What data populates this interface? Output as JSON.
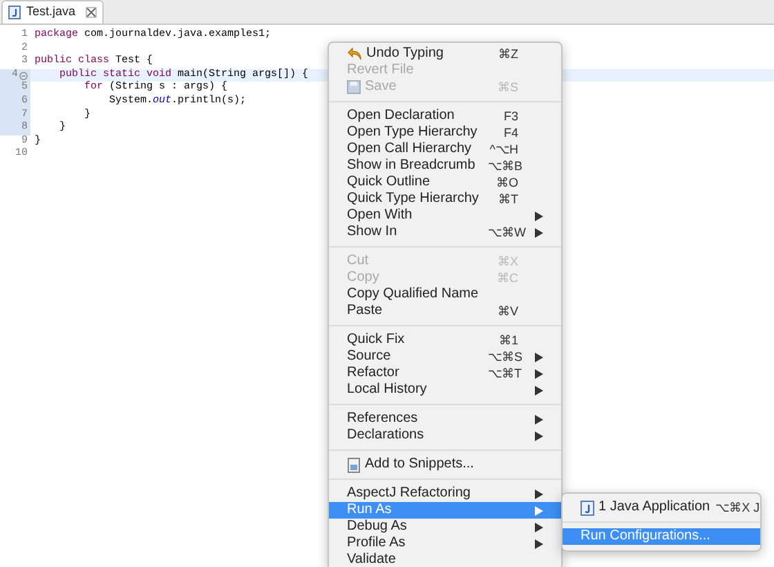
{
  "tab": {
    "title": "Test.java",
    "selected": true
  },
  "code_lines": [
    {
      "number": "1",
      "current": false,
      "in_range": false,
      "foldable": false,
      "tokens": [
        {
          "kind": "keyword",
          "text": "package"
        },
        {
          "kind": "plain",
          "text": " com.journaldev.java.examples1;"
        }
      ]
    },
    {
      "number": "2",
      "current": false,
      "in_range": false,
      "foldable": false
    },
    {
      "number": "3",
      "current": false,
      "in_range": false,
      "foldable": false,
      "tokens": [
        {
          "kind": "keyword",
          "text": "public"
        },
        {
          "kind": "keyword",
          "text": " class"
        },
        {
          "kind": "plain",
          "text": " Test {"
        }
      ]
    },
    {
      "number": "4",
      "current": true,
      "in_range": true,
      "foldable": true,
      "tokens": [
        {
          "kind": "keyword",
          "text": "    public"
        },
        {
          "kind": "keyword",
          "text": " static"
        },
        {
          "kind": "keyword",
          "text": " void"
        },
        {
          "kind": "plain",
          "text": " main(String args[]) {"
        }
      ]
    },
    {
      "number": "5",
      "current": false,
      "in_range": true,
      "foldable": false,
      "tokens": [
        {
          "kind": "keyword",
          "text": "        for"
        },
        {
          "kind": "plain",
          "text": " (String s : args) {"
        }
      ]
    },
    {
      "number": "6",
      "current": false,
      "in_range": true,
      "foldable": false,
      "tokens": [
        {
          "kind": "plain",
          "text": "            System."
        },
        {
          "kind": "field",
          "text": "out"
        },
        {
          "kind": "plain",
          "text": ".println(s);"
        }
      ]
    },
    {
      "number": "7",
      "current": false,
      "in_range": true,
      "foldable": false,
      "tokens": [
        {
          "kind": "plain",
          "text": "        }"
        }
      ]
    },
    {
      "number": "8",
      "current": false,
      "in_range": true,
      "foldable": false,
      "tokens": [
        {
          "kind": "plain",
          "text": "    }"
        }
      ]
    },
    {
      "number": "9",
      "current": false,
      "in_range": false,
      "foldable": false,
      "tokens": [
        {
          "kind": "plain",
          "text": "}"
        }
      ]
    },
    {
      "number": "10",
      "current": false,
      "in_range": false,
      "foldable": false
    }
  ],
  "context_menu": [
    {
      "kind": "item",
      "label": "Undo Typing",
      "shortcut": "⌘Z",
      "disabled": false,
      "selected": false,
      "submenu": false
    },
    {
      "kind": "item",
      "label": "Revert File",
      "disabled": true,
      "selected": false,
      "submenu": false
    },
    {
      "kind": "item",
      "label": "Save",
      "shortcut": "⌘S",
      "disabled": true,
      "selected": false,
      "submenu": false
    },
    {
      "kind": "separator"
    },
    {
      "kind": "item",
      "label": "Open Declaration",
      "shortcut": "F3",
      "disabled": false,
      "selected": false,
      "submenu": false
    },
    {
      "kind": "item",
      "label": "Open Type Hierarchy",
      "shortcut": "F4",
      "disabled": false,
      "selected": false,
      "submenu": false
    },
    {
      "kind": "item",
      "label": "Open Call Hierarchy",
      "shortcut": "^⌥H",
      "disabled": false,
      "selected": false,
      "submenu": false
    },
    {
      "kind": "item",
      "label": "Show in Breadcrumb",
      "shortcut": "⌥⌘B",
      "disabled": false,
      "selected": false,
      "submenu": false
    },
    {
      "kind": "item",
      "label": "Quick Outline",
      "shortcut": "⌘O",
      "disabled": false,
      "selected": false,
      "submenu": false
    },
    {
      "kind": "item",
      "label": "Quick Type Hierarchy",
      "shortcut": "⌘T",
      "disabled": false,
      "selected": false,
      "submenu": false
    },
    {
      "kind": "item",
      "label": "Open With",
      "disabled": false,
      "selected": false,
      "submenu": true
    },
    {
      "kind": "item",
      "label": "Show In",
      "shortcut": "⌥⌘W",
      "disabled": false,
      "selected": false,
      "submenu": true
    },
    {
      "kind": "separator"
    },
    {
      "kind": "item",
      "label": "Cut",
      "shortcut": "⌘X",
      "disabled": true,
      "selected": false,
      "submenu": false
    },
    {
      "kind": "item",
      "label": "Copy",
      "shortcut": "⌘C",
      "disabled": true,
      "selected": false,
      "submenu": false
    },
    {
      "kind": "item",
      "label": "Copy Qualified Name",
      "disabled": false,
      "selected": false,
      "submenu": false
    },
    {
      "kind": "item",
      "label": "Paste",
      "shortcut": "⌘V",
      "disabled": false,
      "selected": false,
      "submenu": false
    },
    {
      "kind": "separator"
    },
    {
      "kind": "item",
      "label": "Quick Fix",
      "shortcut": "⌘1",
      "disabled": false,
      "selected": false,
      "submenu": false
    },
    {
      "kind": "item",
      "label": "Source",
      "shortcut": "⌥⌘S",
      "disabled": false,
      "selected": false,
      "submenu": true
    },
    {
      "kind": "item",
      "label": "Refactor",
      "shortcut": "⌥⌘T",
      "disabled": false,
      "selected": false,
      "submenu": true
    },
    {
      "kind": "item",
      "label": "Local History",
      "disabled": false,
      "selected": false,
      "submenu": true
    },
    {
      "kind": "separator"
    },
    {
      "kind": "item",
      "label": "References",
      "disabled": false,
      "selected": false,
      "submenu": true
    },
    {
      "kind": "item",
      "label": "Declarations",
      "disabled": false,
      "selected": false,
      "submenu": true
    },
    {
      "kind": "separator"
    },
    {
      "kind": "item",
      "label": "Add to Snippets...",
      "disabled": false,
      "selected": false,
      "submenu": false
    },
    {
      "kind": "separator"
    },
    {
      "kind": "item",
      "label": "AspectJ Refactoring",
      "disabled": false,
      "selected": false,
      "submenu": true
    },
    {
      "kind": "item",
      "label": "Run As",
      "disabled": false,
      "selected": true,
      "submenu": true
    },
    {
      "kind": "item",
      "label": "Debug As",
      "disabled": false,
      "selected": false,
      "submenu": true
    },
    {
      "kind": "item",
      "label": "Profile As",
      "disabled": false,
      "selected": false,
      "submenu": true
    },
    {
      "kind": "item",
      "label": "Validate",
      "disabled": false,
      "selected": false,
      "submenu": false
    }
  ],
  "submenu": [
    {
      "kind": "item",
      "label": "1 Java Application",
      "shortcut": "⌥⌘X J",
      "disabled": false,
      "selected": false
    },
    {
      "kind": "separator"
    },
    {
      "kind": "item",
      "label": "Run Configurations...",
      "disabled": false,
      "selected": true
    }
  ]
}
